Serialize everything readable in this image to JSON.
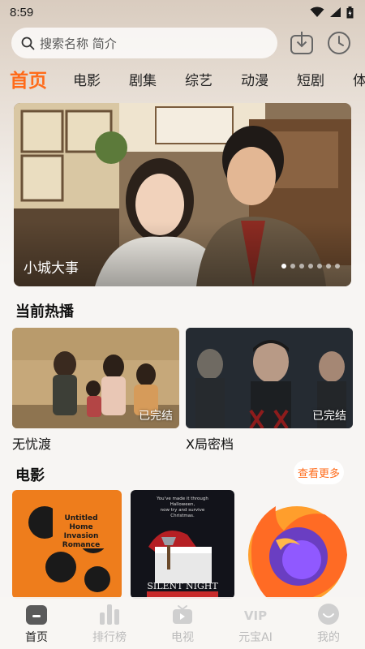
{
  "status": {
    "time": "8:59"
  },
  "search": {
    "placeholder": "搜索名称 简介"
  },
  "categories": [
    "首页",
    "电影",
    "剧集",
    "综艺",
    "动漫",
    "短剧",
    "体"
  ],
  "banner": {
    "title": "小城大事",
    "slide_count": 7,
    "active_index": 0
  },
  "hot": {
    "title": "当前热播",
    "items": [
      {
        "name": "无忧渡",
        "badge": "已完结"
      },
      {
        "name": "X局密档",
        "badge": "已完结"
      }
    ]
  },
  "movies": {
    "title": "电影",
    "more": "查看更多"
  },
  "posters": {
    "p1": "Untitled Home Invasion Romance",
    "p2_tag": "You've made it through Halloween, now try and survive Christmas.",
    "p2_title": "SILENT NIGHT"
  },
  "nav": [
    {
      "label": "首页",
      "icon": "home-icon",
      "active": true
    },
    {
      "label": "排行榜",
      "icon": "ranking-icon",
      "active": false
    },
    {
      "label": "电视",
      "icon": "tv-icon",
      "active": false
    },
    {
      "label": "元宝AI",
      "icon": "vip-icon",
      "active": false
    },
    {
      "label": "我的",
      "icon": "profile-icon",
      "active": false
    }
  ],
  "colors": {
    "accent": "#ff6b1a",
    "background": "#f7f5f3"
  }
}
